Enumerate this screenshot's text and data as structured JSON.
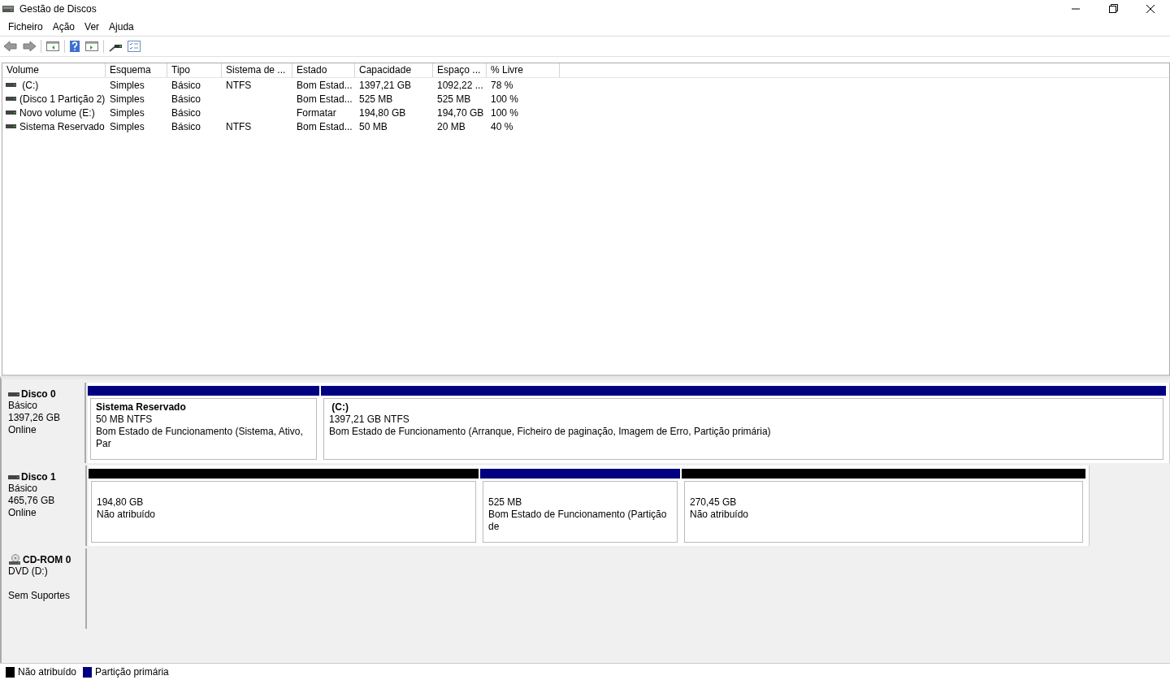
{
  "window": {
    "title": "Gestão de Discos"
  },
  "menu": [
    "Ficheiro",
    "Ação",
    "Ver",
    "Ajuda"
  ],
  "table": {
    "columns": [
      "Volume",
      "Esquema",
      "Tipo",
      "Sistema de ...",
      "Estado",
      "Capacidade",
      "Espaço ...",
      "% Livre"
    ],
    "rows": [
      {
        "cells": [
          " (C:)",
          "Simples",
          "Básico",
          "NTFS",
          "Bom Estad...",
          "1397,21 GB",
          "1092,22 ...",
          "78 %"
        ]
      },
      {
        "cells": [
          "(Disco 1 Partição 2)",
          "Simples",
          "Básico",
          "",
          "Bom Estad...",
          "525 MB",
          "525 MB",
          "100 %"
        ]
      },
      {
        "cells": [
          "Novo volume (E:)",
          "Simples",
          "Básico",
          "",
          "Formatar",
          "194,80 GB",
          "194,70 GB",
          "100 %"
        ]
      },
      {
        "cells": [
          "Sistema Reservado",
          "Simples",
          "Básico",
          "NTFS",
          "Bom Estad...",
          "50 MB",
          "20 MB",
          "40 %"
        ]
      }
    ]
  },
  "disks": [
    {
      "kind": "hdd",
      "name": "Disco 0",
      "lines": [
        "Básico",
        "1397,26 GB",
        "Online"
      ],
      "partitions": [
        {
          "color": "#000080",
          "name": "Sistema Reservado",
          "lines": [
            "50 MB NTFS",
            "Bom Estado de Funcionamento (Sistema, Ativo, Par"
          ]
        },
        {
          "color": "#000080",
          "name": " (C:)",
          "lines": [
            "1397,21 GB NTFS",
            "Bom Estado de Funcionamento (Arranque, Ficheiro de paginação, Imagem de Erro, Partição primária)"
          ]
        }
      ]
    },
    {
      "kind": "hdd",
      "name": "Disco 1",
      "lines": [
        "Básico",
        "465,76 GB",
        "Online"
      ],
      "partitions": [
        {
          "color": "#000000",
          "lines": [
            "194,80 GB",
            "Não atribuído"
          ]
        },
        {
          "color": "#000080",
          "lines": [
            "525 MB",
            "Bom Estado de Funcionamento (Partição de"
          ]
        },
        {
          "color": "#000000",
          "lines": [
            "270,45 GB",
            "Não atribuído"
          ]
        }
      ]
    },
    {
      "kind": "cdrom",
      "name": "CD-ROM 0",
      "lines": [
        "DVD (D:)",
        "Sem Suportes"
      ]
    }
  ],
  "legend": [
    {
      "color": "#000000",
      "label": "Não atribuído"
    },
    {
      "color": "#000080",
      "label": "Partição primária"
    }
  ]
}
